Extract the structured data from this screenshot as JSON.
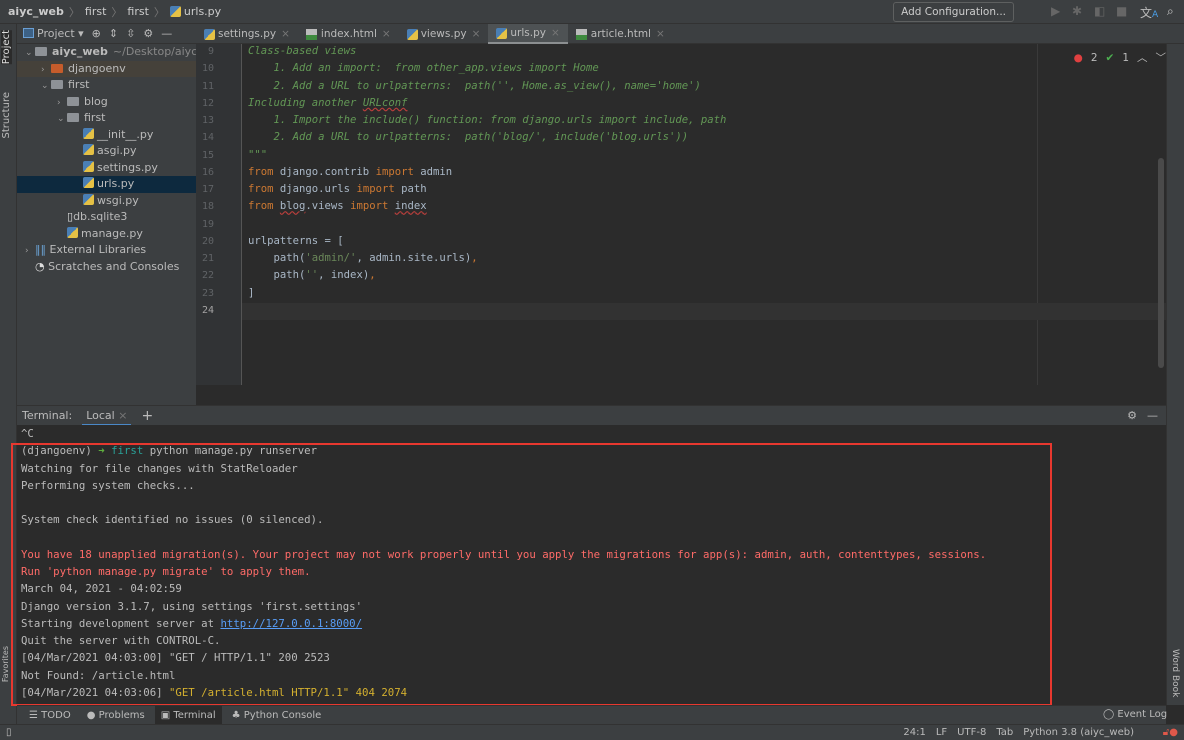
{
  "breadcrumb": {
    "items": [
      "aiyc_web",
      "first",
      "first",
      "urls.py"
    ]
  },
  "toolbar": {
    "add_configuration": "Add Configuration...",
    "icons": [
      "run-icon",
      "debug-icon",
      "coverage-icon",
      "stop-icon",
      "translate-icon",
      "search-icon"
    ]
  },
  "left_strip": {
    "project": "Project",
    "structure": "Structure",
    "favorites": "Favorites"
  },
  "right_strip": {
    "word_book": "Word Book"
  },
  "project_panel": {
    "title": "Project",
    "tree": [
      {
        "label": "aiyc_web",
        "hint": "~/Desktop/aiyc_web",
        "type": "folder",
        "depth": 0,
        "expanded": true
      },
      {
        "label": "djangoenv",
        "type": "folder-orange",
        "depth": 1,
        "expanded": false
      },
      {
        "label": "first",
        "type": "folder",
        "depth": 1,
        "expanded": true
      },
      {
        "label": "blog",
        "type": "package",
        "depth": 2,
        "expanded": false
      },
      {
        "label": "first",
        "type": "package",
        "depth": 2,
        "expanded": true
      },
      {
        "label": "__init__.py",
        "type": "py",
        "depth": 3
      },
      {
        "label": "asgi.py",
        "type": "py",
        "depth": 3
      },
      {
        "label": "settings.py",
        "type": "py",
        "depth": 3
      },
      {
        "label": "urls.py",
        "type": "py",
        "depth": 3,
        "selected": true
      },
      {
        "label": "wsgi.py",
        "type": "py",
        "depth": 3
      },
      {
        "label": "db.sqlite3",
        "type": "file",
        "depth": 2
      },
      {
        "label": "manage.py",
        "type": "py",
        "depth": 2
      },
      {
        "label": "External Libraries",
        "type": "lib",
        "depth": 0,
        "expanded": false
      },
      {
        "label": "Scratches and Consoles",
        "type": "scratch",
        "depth": 0
      }
    ]
  },
  "tabs": [
    {
      "label": "settings.py",
      "type": "py"
    },
    {
      "label": "index.html",
      "type": "html"
    },
    {
      "label": "views.py",
      "type": "py"
    },
    {
      "label": "urls.py",
      "type": "py",
      "active": true
    },
    {
      "label": "article.html",
      "type": "html"
    }
  ],
  "inspections": {
    "errors": "2",
    "warnings": "1"
  },
  "editor": {
    "current_line": 24,
    "lines": [
      {
        "n": "9",
        "t": [
          [
            "Class-based views",
            "c"
          ]
        ]
      },
      {
        "n": "10",
        "t": [
          [
            "    1. Add an import:  from other_app.views import Home",
            "c"
          ]
        ]
      },
      {
        "n": "11",
        "t": [
          [
            "    2. Add a URL to urlpatterns:  path('', Home.as_view(), name='home')",
            "c"
          ]
        ]
      },
      {
        "n": "12",
        "t": [
          [
            "Including another ",
            "c"
          ],
          [
            "URLconf",
            "c u"
          ]
        ]
      },
      {
        "n": "13",
        "t": [
          [
            "    1. Import the include() function: from django.urls import include, path",
            "c"
          ]
        ]
      },
      {
        "n": "14",
        "t": [
          [
            "    2. Add a URL to urlpatterns:  path('blog/', include('blog.urls'))",
            "c"
          ]
        ]
      },
      {
        "n": "15",
        "t": [
          [
            "\"\"\"",
            "c"
          ]
        ]
      },
      {
        "n": "16",
        "t": [
          [
            "from",
            "k"
          ],
          [
            " django.contrib ",
            ""
          ],
          [
            "import",
            "k"
          ],
          [
            " admin",
            ""
          ]
        ]
      },
      {
        "n": "17",
        "t": [
          [
            "from",
            "k"
          ],
          [
            " django.urls ",
            ""
          ],
          [
            "import",
            "k"
          ],
          [
            " path",
            ""
          ]
        ]
      },
      {
        "n": "18",
        "t": [
          [
            "from",
            "k"
          ],
          [
            " ",
            ""
          ],
          [
            "blog",
            "u"
          ],
          [
            ".views ",
            ""
          ],
          [
            "import",
            "k"
          ],
          [
            " ",
            ""
          ],
          [
            "index",
            "u"
          ]
        ]
      },
      {
        "n": "19",
        "t": []
      },
      {
        "n": "20",
        "t": [
          [
            "urlpatterns = [",
            ""
          ]
        ]
      },
      {
        "n": "21",
        "t": [
          [
            "    path(",
            ""
          ],
          [
            "'admin/'",
            "s"
          ],
          [
            ", admin.site.urls)",
            ""
          ],
          [
            ",",
            "k"
          ]
        ]
      },
      {
        "n": "22",
        "t": [
          [
            "    path(",
            ""
          ],
          [
            "''",
            "s"
          ],
          [
            ", index)",
            ""
          ],
          [
            ",",
            "k"
          ]
        ]
      },
      {
        "n": "23",
        "t": [
          [
            "]",
            ""
          ]
        ]
      },
      {
        "n": "24",
        "t": []
      }
    ]
  },
  "terminal": {
    "label": "Terminal:",
    "tab": "Local",
    "lines": [
      [
        [
          "^C",
          ""
        ]
      ],
      [
        [
          "(djangoenv) ",
          ""
        ],
        [
          "➜ ",
          "grn"
        ],
        [
          "first",
          "cyan"
        ],
        [
          " python manage.py runserver",
          ""
        ]
      ],
      [
        [
          "Watching for file changes with StatReloader",
          ""
        ]
      ],
      [
        [
          "Performing system checks...",
          ""
        ]
      ],
      [],
      [
        [
          "System check identified no issues (0 silenced).",
          ""
        ]
      ],
      [],
      [
        [
          "You have 18 unapplied migration(s). Your project may not work properly until you apply the migrations for app(s): admin, auth, contenttypes, sessions.",
          "red"
        ]
      ],
      [
        [
          "Run 'python manage.py migrate' to apply them.",
          "red"
        ]
      ],
      [
        [
          "March 04, 2021 - 04:02:59",
          ""
        ]
      ],
      [
        [
          "Django version 3.1.7, using settings 'first.settings'",
          ""
        ]
      ],
      [
        [
          "Starting development server at ",
          ""
        ],
        [
          "http://127.0.0.1:8000/",
          "link"
        ]
      ],
      [
        [
          "Quit the server with CONTROL-C.",
          ""
        ]
      ],
      [
        [
          "[04/Mar/2021 04:03:00] \"GET / HTTP/1.1\" 200 2523",
          ""
        ]
      ],
      [
        [
          "Not Found: /article.html",
          ""
        ]
      ],
      [
        [
          "[04/Mar/2021 04:03:06] ",
          ""
        ],
        [
          "\"GET /article.html HTTP/1.1\" 404 2074",
          "yel"
        ]
      ]
    ]
  },
  "bottom_tools": [
    {
      "label": "TODO",
      "icon": "list-icon"
    },
    {
      "label": "Problems",
      "icon": "problems-icon"
    },
    {
      "label": "Terminal",
      "icon": "terminal-icon",
      "active": true
    },
    {
      "label": "Python Console",
      "icon": "python-icon"
    }
  ],
  "event_log": "Event Log",
  "status": {
    "position": "24:1",
    "line_sep": "LF",
    "encoding": "UTF-8",
    "indent": "Tab",
    "interpreter": "Python 3.8 (aiyc_web)"
  },
  "colors": {
    "highlight": "#e8382f",
    "keyword": "#cc7832",
    "comment": "#629755",
    "error": "#ff6b68"
  }
}
